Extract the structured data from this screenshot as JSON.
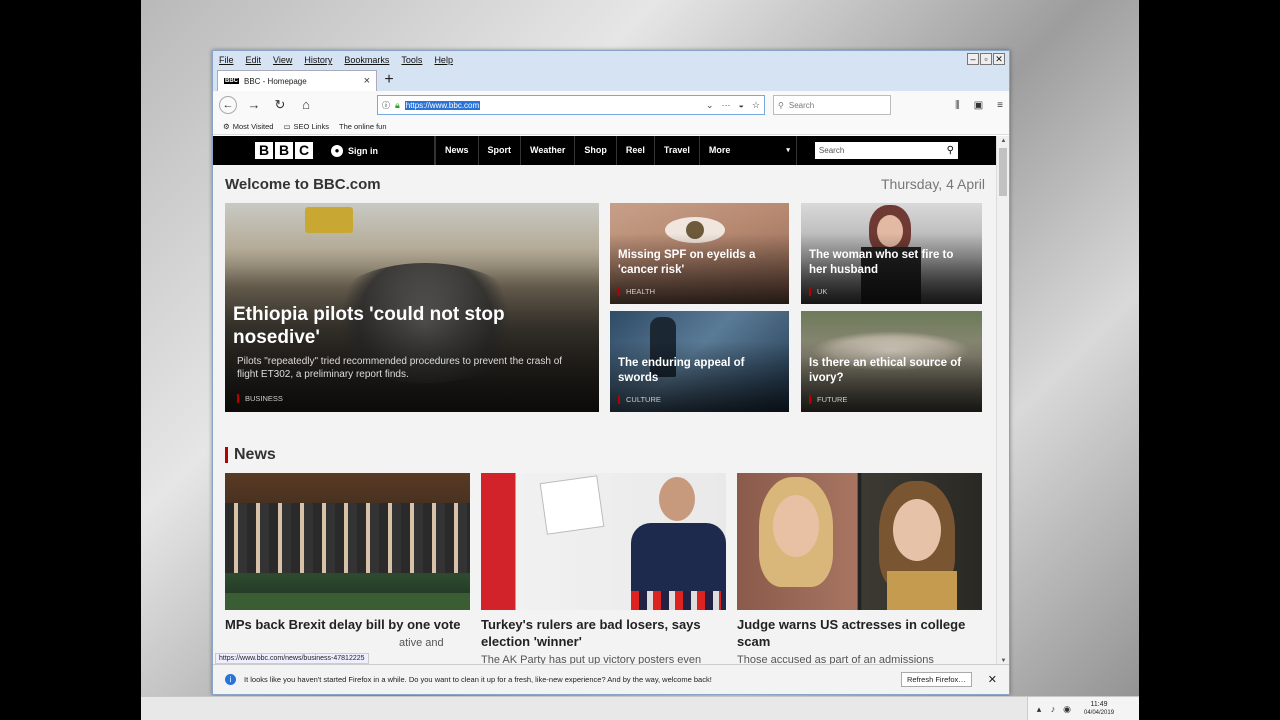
{
  "menubar": {
    "items": [
      "File",
      "Edit",
      "View",
      "History",
      "Bookmarks",
      "Tools",
      "Help"
    ]
  },
  "tab": {
    "title": "BBC - Homepage",
    "favicon": "BBC"
  },
  "address": {
    "url": "https://www.bbc.com",
    "search_placeholder": "Search"
  },
  "bookmarks": {
    "items": [
      "Most Visited",
      "SEO Links",
      "The online fun"
    ]
  },
  "bbc": {
    "logo": [
      "B",
      "B",
      "C"
    ],
    "signin": "Sign in",
    "nav": [
      "News",
      "Sport",
      "Weather",
      "Shop",
      "Reel",
      "Travel",
      "More"
    ],
    "search_placeholder": "Search",
    "welcome": "Welcome to BBC.com",
    "date": "Thursday, 4 April",
    "lead": {
      "title": "Ethiopia pilots 'could not stop nosedive'",
      "desc": "Pilots \"repeatedly\" tried recommended procedures to prevent the crash of flight ET302, a preliminary report finds.",
      "tag": "BUSINESS"
    },
    "stories": [
      {
        "title": "Missing SPF on eyelids a 'cancer risk'",
        "tag": "HEALTH"
      },
      {
        "title": "The woman who set fire to her husband",
        "tag": "UK"
      },
      {
        "title": "The enduring appeal of swords",
        "tag": "CULTURE"
      },
      {
        "title": "Is there an ethical source of ivory?",
        "tag": "FUTURE"
      }
    ],
    "news_heading": "News",
    "news": [
      {
        "title": "MPs back Brexit delay bill by one vote",
        "desc": "ative and"
      },
      {
        "title": "Turkey's rulers are bad losers, says election 'winner'",
        "desc": "The AK Party has put up victory posters even"
      },
      {
        "title": "Judge warns US actresses in college scam",
        "desc": "Those accused as part of an admissions"
      }
    ]
  },
  "status_link": "https://www.bbc.com/news/business-47812225",
  "notification": {
    "text": "It looks like you haven't started Firefox in a while. Do you want to clean it up for a fresh, like-new experience? And by the way, welcome back!",
    "button": "Refresh Firefox…"
  },
  "clock": {
    "time": "11:49",
    "date": "04/04/2019"
  }
}
